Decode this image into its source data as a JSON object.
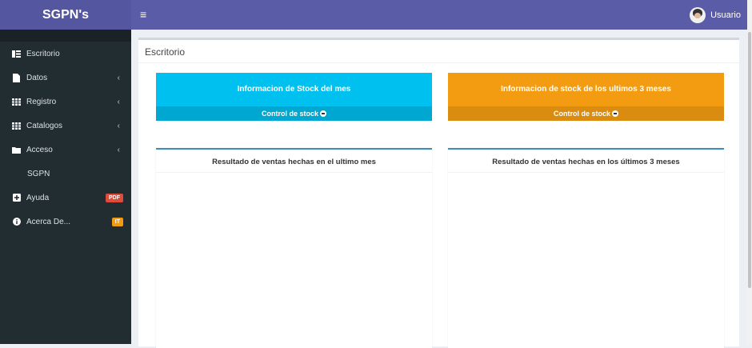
{
  "header": {
    "brand": "SGPN's",
    "menu_icon": "≡",
    "user": "Usuario"
  },
  "sidebar": {
    "items": [
      {
        "icon": "dashboard-icon",
        "label": "Escritorio"
      },
      {
        "icon": "file-icon",
        "label": "Datos",
        "chevron": "‹"
      },
      {
        "icon": "table-icon",
        "label": "Registro",
        "chevron": "‹"
      },
      {
        "icon": "table-icon",
        "label": "Catalogos",
        "chevron": "‹"
      },
      {
        "icon": "folder-icon",
        "label": "Acceso",
        "chevron": "‹"
      },
      {
        "label": "SGPN"
      },
      {
        "icon": "plus-square-icon",
        "label": "Ayuda",
        "badge": "PDF",
        "badge_color": "#dd4b39"
      },
      {
        "icon": "info-circle-icon",
        "label": "Acerca De...",
        "badge": "IT",
        "badge_color": "#f39c12"
      }
    ]
  },
  "main": {
    "title": "Escritorio",
    "tiles": [
      {
        "title": "Informacion de Stock del mes",
        "footer": "Control de stock",
        "color": "#00c0ef",
        "footer_color": "#00a7d0"
      },
      {
        "title": "Informacion de stock de los ultimos 3 meses",
        "footer": "Control de stock",
        "color": "#f39c12",
        "footer_color": "#da8c10"
      }
    ],
    "panels": [
      {
        "title": "Resultado de ventas hechas en el ultimo mes"
      },
      {
        "title": "Resultado de ventas hechas en los últimos 3 meses"
      }
    ]
  }
}
